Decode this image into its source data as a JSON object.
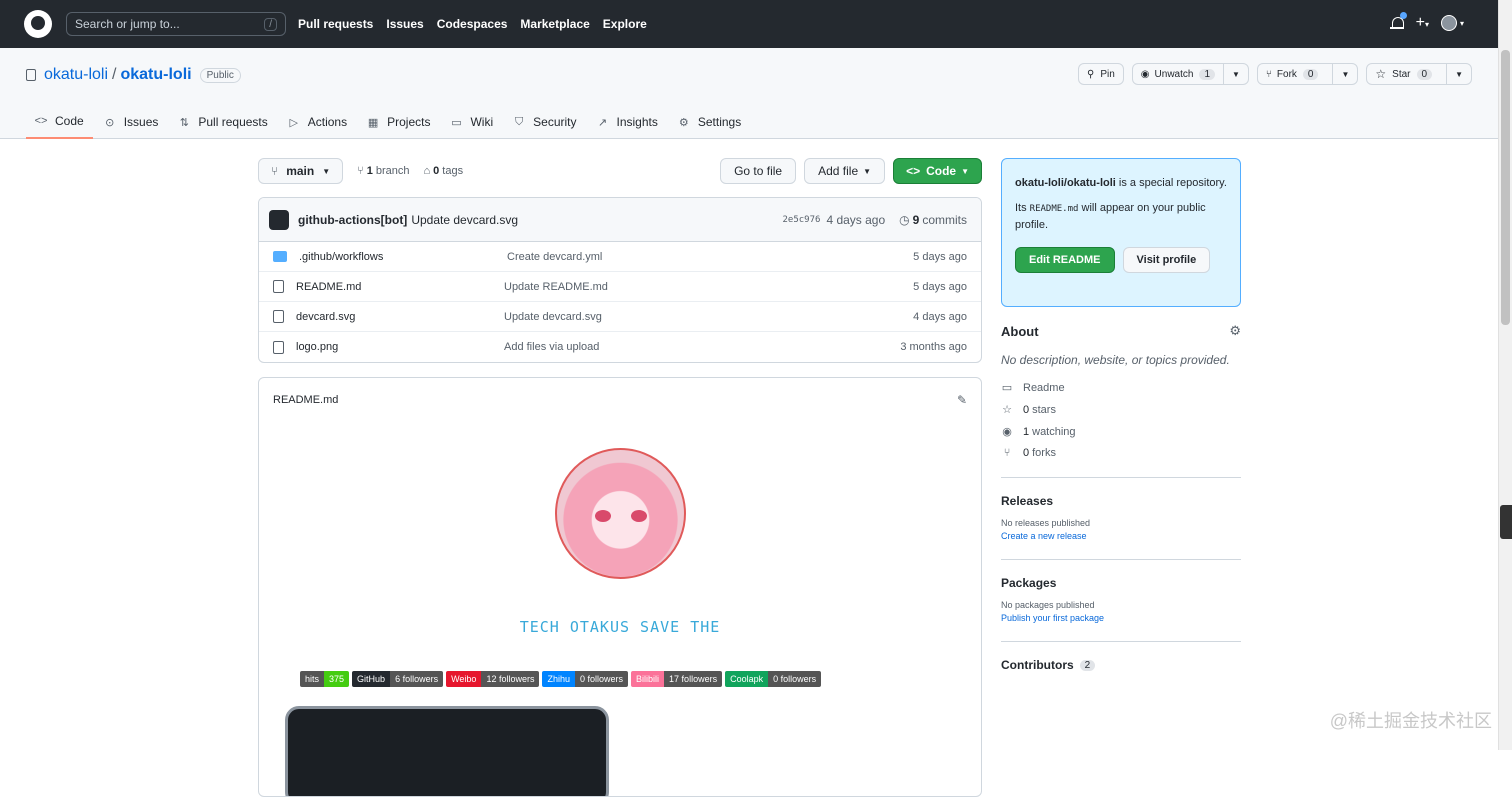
{
  "header": {
    "search_placeholder": "Search or jump to...",
    "search_shortcut": "/",
    "nav": [
      "Pull requests",
      "Issues",
      "Codespaces",
      "Marketplace",
      "Explore"
    ]
  },
  "repo": {
    "owner": "okatu-loli",
    "separator": "/",
    "name": "okatu-loli",
    "visibility": "Public",
    "pin_label": "Pin",
    "unwatch_label": "Unwatch",
    "watch_count": "1",
    "fork_label": "Fork",
    "fork_count": "0",
    "star_label": "Star",
    "star_count": "0"
  },
  "tabs": [
    {
      "label": "Code",
      "icon": "code-icon"
    },
    {
      "label": "Issues",
      "icon": "issue-icon"
    },
    {
      "label": "Pull requests",
      "icon": "pull-request-icon"
    },
    {
      "label": "Actions",
      "icon": "play-icon"
    },
    {
      "label": "Projects",
      "icon": "table-icon"
    },
    {
      "label": "Wiki",
      "icon": "book-icon"
    },
    {
      "label": "Security",
      "icon": "shield-icon"
    },
    {
      "label": "Insights",
      "icon": "graph-icon"
    },
    {
      "label": "Settings",
      "icon": "gear-icon"
    }
  ],
  "branch": {
    "current": "main",
    "branch_count": "1",
    "branch_word": "branch",
    "tag_count": "0",
    "tag_word": "tags",
    "go_to_file": "Go to file",
    "add_file": "Add file",
    "code_button": "Code"
  },
  "last_commit": {
    "author": "github-actions[bot]",
    "message": "Update devcard.svg",
    "sha": "2e5c976",
    "age": "4 days ago",
    "commit_count": "9",
    "commit_word": "commits"
  },
  "files": [
    {
      "type": "folder",
      "name": ".github/workflows",
      "message": "Create devcard.yml",
      "age": "5 days ago"
    },
    {
      "type": "file",
      "name": "README.md",
      "message": "Update README.md",
      "age": "5 days ago"
    },
    {
      "type": "file",
      "name": "devcard.svg",
      "message": "Update devcard.svg",
      "age": "4 days ago"
    },
    {
      "type": "file",
      "name": "logo.png",
      "message": "Add files via upload",
      "age": "3 months ago"
    }
  ],
  "readme": {
    "title": "README.md",
    "slogan": "TECH OTAKUS SAVE THE",
    "badges": [
      {
        "left": "hits",
        "right": "375",
        "color": "#4c1"
      },
      {
        "left": "GitHub",
        "right": "6 followers",
        "color": "#24292f"
      },
      {
        "left": "Weibo",
        "right": "12 followers",
        "color": "#e6162d"
      },
      {
        "left": "Zhihu",
        "right": "0 followers",
        "color": "#0084ff"
      },
      {
        "left": "Bilibili",
        "right": "17 followers",
        "color": "#fb7299"
      },
      {
        "left": "Coolapk",
        "right": "0 followers",
        "color": "#11a45c"
      }
    ]
  },
  "sidebar": {
    "special": {
      "repo": "okatu-loli/okatu-loli",
      "text1": " is a special repository.",
      "text2a": "Its ",
      "code": "README.md",
      "text2b": " will appear on your public profile.",
      "edit_button": "Edit README",
      "visit_button": "Visit profile"
    },
    "about": {
      "title": "About",
      "description": "No description, website, or topics provided.",
      "readme": "Readme",
      "stars_count": "0",
      "stars_word": "stars",
      "watching_count": "1",
      "watching_word": "watching",
      "forks_count": "0",
      "forks_word": "forks"
    },
    "releases": {
      "title": "Releases",
      "none": "No releases published",
      "link": "Create a new release"
    },
    "packages": {
      "title": "Packages",
      "none": "No packages published",
      "link": "Publish your first package"
    },
    "contributors": {
      "title": "Contributors",
      "count": "2"
    }
  },
  "watermark": "@稀土掘金技术社区"
}
